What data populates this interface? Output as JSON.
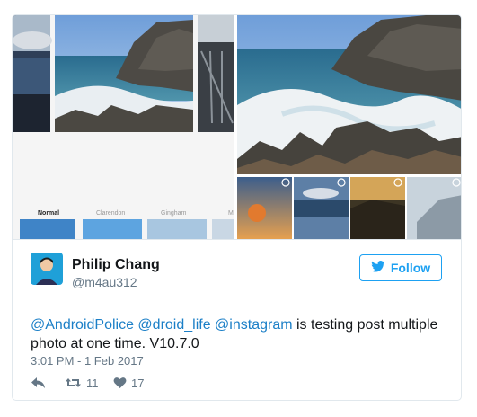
{
  "media": {
    "filter_labels": [
      "Normal",
      "Clarendon",
      "Gingham",
      "M"
    ]
  },
  "tweet": {
    "author_name": "Philip Chang",
    "author_handle": "@m4au312",
    "follow_label": "Follow",
    "mentions": [
      "@AndroidPolice",
      "@droid_life",
      "@instagram"
    ],
    "text": "is testing post multiple photo at one time. V10.7.0",
    "timestamp": "3:01 PM - 1 Feb 2017",
    "retweet_count": "11",
    "like_count": "17"
  },
  "icons": {
    "reply": "reply-icon",
    "retweet": "retweet-icon",
    "like": "heart-icon",
    "follow": "twitter-bird-icon"
  },
  "colors": {
    "twitter_blue": "#1da1f2",
    "mention_blue": "#1b7fc7",
    "text_primary": "#14171a",
    "text_secondary": "#657786"
  }
}
